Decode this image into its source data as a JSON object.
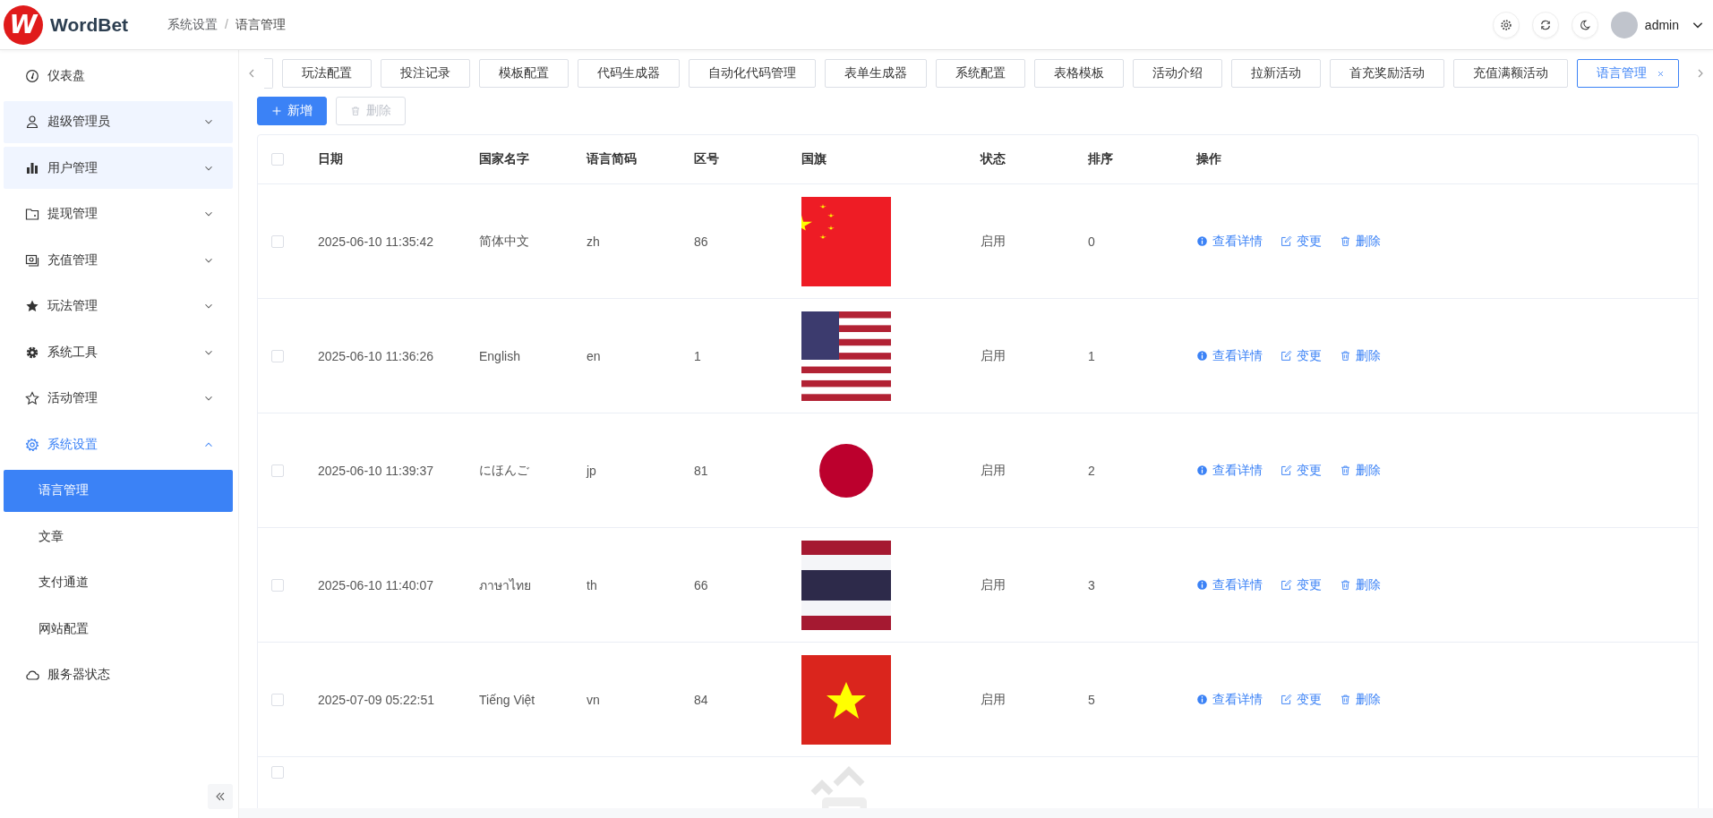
{
  "header": {
    "logo_mark": "W",
    "brand": "WordBet",
    "breadcrumb": [
      "系统设置",
      "语言管理"
    ],
    "breadcrumb_separator": "/",
    "user": "admin"
  },
  "sidebar": {
    "items": [
      {
        "label": "仪表盘",
        "highlighted": false,
        "selected": false
      },
      {
        "label": "超级管理员",
        "highlighted": true,
        "selected": false,
        "expanded": false
      },
      {
        "label": "用户管理",
        "highlighted": true,
        "selected": false,
        "expanded": false
      },
      {
        "label": "提现管理",
        "highlighted": false,
        "selected": false,
        "expanded": false
      },
      {
        "label": "充值管理",
        "highlighted": false,
        "selected": false,
        "expanded": false
      },
      {
        "label": "玩法管理",
        "highlighted": false,
        "selected": false,
        "expanded": false
      },
      {
        "label": "系统工具",
        "highlighted": false,
        "selected": false,
        "expanded": false
      },
      {
        "label": "活动管理",
        "highlighted": false,
        "selected": false,
        "expanded": false
      },
      {
        "label": "系统设置",
        "highlighted": false,
        "selected": true,
        "expanded": true,
        "children": [
          {
            "label": "语言管理",
            "selected": true
          },
          {
            "label": "文章",
            "selected": false
          },
          {
            "label": "支付通道",
            "selected": false
          },
          {
            "label": "网站配置",
            "selected": false
          }
        ]
      },
      {
        "label": "服务器状态",
        "highlighted": false,
        "selected": false
      }
    ]
  },
  "tabs": [
    {
      "label": "玩法配置",
      "selected": false
    },
    {
      "label": "投注记录",
      "selected": false
    },
    {
      "label": "模板配置",
      "selected": false
    },
    {
      "label": "代码生成器",
      "selected": false
    },
    {
      "label": "自动化代码管理",
      "selected": false
    },
    {
      "label": "表单生成器",
      "selected": false
    },
    {
      "label": "系统配置",
      "selected": false
    },
    {
      "label": "表格模板",
      "selected": false
    },
    {
      "label": "活动介绍",
      "selected": false
    },
    {
      "label": "拉新活动",
      "selected": false
    },
    {
      "label": "首充奖励活动",
      "selected": false
    },
    {
      "label": "充值满额活动",
      "selected": false
    },
    {
      "label": "语言管理",
      "selected": true
    }
  ],
  "toolbar": [
    {
      "label": "新增",
      "disabled": false
    },
    {
      "label": "删除",
      "disabled": true
    }
  ],
  "table": {
    "select_all_checked": false,
    "columns": [
      "日期",
      "国家名字",
      "语言简码",
      "区号",
      "国旗",
      "状态",
      "排序",
      "操作"
    ],
    "rows": [
      {
        "checked": false,
        "date": "2025-06-10 11:35:42",
        "country": "简体中文",
        "code": "zh",
        "zone": "86",
        "status": "启用",
        "sort": "0",
        "actions": [
          "查看详情",
          "变更",
          "删除"
        ]
      },
      {
        "checked": false,
        "date": "2025-06-10 11:36:26",
        "country": "English",
        "code": "en",
        "zone": "1",
        "status": "启用",
        "sort": "1",
        "actions": [
          "查看详情",
          "变更",
          "删除"
        ]
      },
      {
        "checked": false,
        "date": "2025-06-10 11:39:37",
        "country": "にほんご",
        "code": "jp",
        "zone": "81",
        "status": "启用",
        "sort": "2",
        "actions": [
          "查看详情",
          "变更",
          "删除"
        ]
      },
      {
        "checked": false,
        "date": "2025-06-10 11:40:07",
        "country": "ภาษาไทย",
        "code": "th",
        "zone": "66",
        "status": "启用",
        "sort": "3",
        "actions": [
          "查看详情",
          "变更",
          "删除"
        ]
      },
      {
        "checked": false,
        "date": "2025-07-09 05:22:51",
        "country": "Tiếng Việt",
        "code": "vn",
        "zone": "84",
        "status": "启用",
        "sort": "5",
        "actions": [
          "查看详情",
          "变更",
          "删除"
        ]
      }
    ],
    "partial_row": {
      "checked": false
    }
  }
}
